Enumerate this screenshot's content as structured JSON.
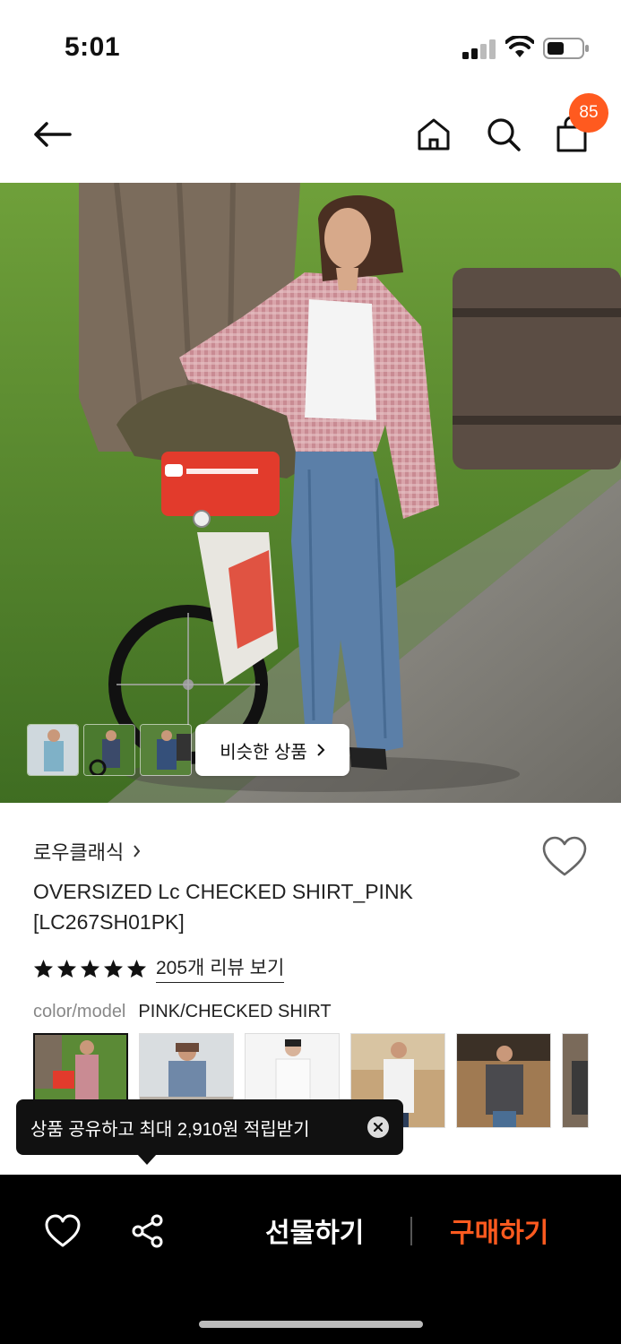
{
  "status_bar": {
    "time": "5:01"
  },
  "header": {
    "cart_count": "85"
  },
  "hero": {
    "similar_products_label": "비슷한 상품"
  },
  "product": {
    "brand": "로우클래식",
    "name": "OVERSIZED Lc CHECKED SHIRT_PINK [LC267SH01PK]",
    "rating_stars": 5,
    "review_link": "205개 리뷰 보기",
    "option_label": "color/model",
    "option_value": "PINK/CHECKED SHIRT"
  },
  "tooltip": {
    "text": "상품 공유하고 최대 2,910원 적립받기"
  },
  "bottom_bar": {
    "gift_label": "선물하기",
    "buy_label": "구매하기"
  },
  "colors": {
    "accent": "#ff5a1f",
    "bar_bg": "#000000"
  },
  "icons": [
    "back-arrow-icon",
    "home-icon",
    "search-icon",
    "shopping-bag-icon",
    "heart-icon",
    "share-icon",
    "close-icon",
    "chevron-right-icon",
    "star-icon"
  ]
}
